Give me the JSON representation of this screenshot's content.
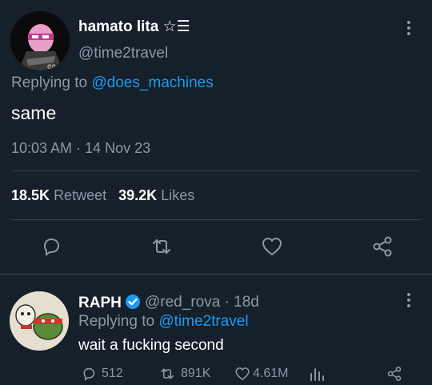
{
  "tweet": {
    "display_name": "hamato lita",
    "name_decoration": "☆☰",
    "handle": "@time2travel",
    "replying_prefix": "Replying to",
    "replying_to": "@does_machines",
    "text": "same",
    "timestamp": "10:03 AM · 14 Nov 23",
    "retweet_count": "18.5K",
    "retweet_label": "Retweet",
    "like_count": "39.2K",
    "like_label": "Likes"
  },
  "reply": {
    "display_name": "RAPH",
    "handle_time": "@red_rova · 18d",
    "replying_prefix": "Replying to",
    "replying_to": "@time2travel",
    "text": "wait a fucking second",
    "reply_count": "512",
    "retweet_count": "891K",
    "like_count": "4.61M"
  },
  "colors": {
    "background": "#15202b",
    "accent": "#1d9bf0",
    "muted": "#8b98a5",
    "divider": "#38444d"
  },
  "icons": [
    "more-icon",
    "reply-icon",
    "retweet-icon",
    "like-icon",
    "share-icon",
    "verified-icon",
    "views-icon"
  ]
}
